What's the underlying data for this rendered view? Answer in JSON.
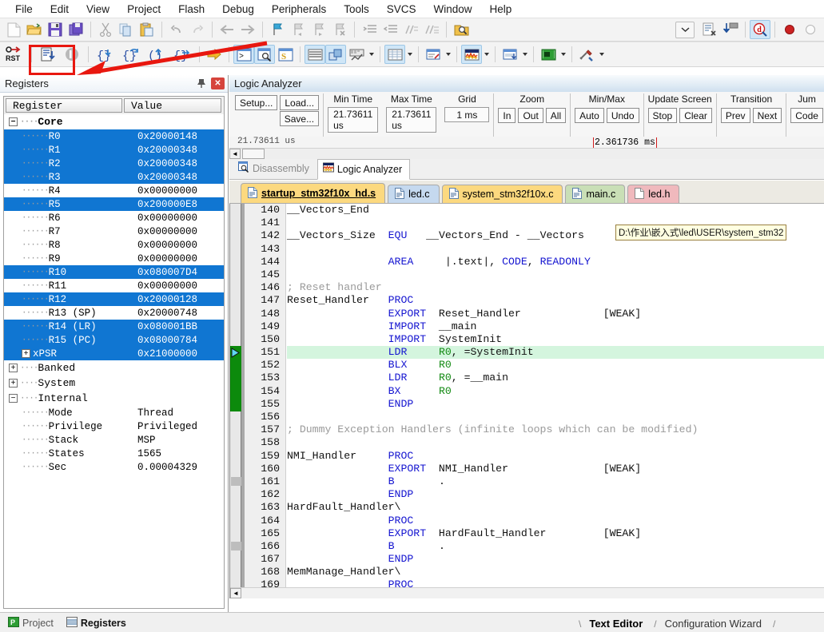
{
  "menubar": {
    "items": [
      "File",
      "Edit",
      "View",
      "Project",
      "Flash",
      "Debug",
      "Peripherals",
      "Tools",
      "SVCS",
      "Window",
      "Help"
    ]
  },
  "toolbar_main": {
    "icons": [
      "new-file-icon",
      "open-folder-icon",
      "save-icon",
      "save-all-icon",
      "cut-icon",
      "copy-icon",
      "paste-icon",
      "undo-icon",
      "redo-icon",
      "navigate-back-icon",
      "navigate-forward-icon",
      "bookmark-toggle-icon",
      "bookmark-prev-icon",
      "bookmark-next-icon",
      "bookmark-clear-icon",
      "indent-icon",
      "outdent-icon",
      "comment-icon",
      "uncomment-icon",
      "find-in-files-icon",
      "target-select-dropdown-icon",
      "build-target-icon",
      "download-icon",
      "start-debug-icon",
      "insert-breakpoint-icon",
      "disable-breakpoint-icon"
    ]
  },
  "toolbar_debug": {
    "icons": [
      "reset-cpu-icon",
      "run-icon",
      "stop-icon",
      "step-into-icon",
      "step-over-icon",
      "step-out-icon",
      "run-to-cursor-icon",
      "show-next-statement-icon",
      "command-window-icon",
      "disassembly-window-icon",
      "symbols-window-icon",
      "registers-window-icon",
      "call-stack-icon",
      "watch-window-icon",
      "memory-window-icon",
      "serial-window-icon",
      "analysis-window-icon",
      "trace-window-icon",
      "system-viewer-icon",
      "toolbox-icon"
    ],
    "highlighted_icon": "run-icon"
  },
  "registers_pane": {
    "title": "Registers",
    "pin_icon": "pin-icon",
    "close_icon": "close-icon",
    "columns": [
      "Register",
      "Value"
    ],
    "groups": [
      {
        "name": "Core",
        "expander": "−",
        "expanded": true
      },
      {
        "name": "Banked",
        "expander": "+",
        "expanded": false
      },
      {
        "name": "System",
        "expander": "+",
        "expanded": false
      },
      {
        "name": "Internal",
        "expander": "−",
        "expanded": true
      }
    ],
    "core_rows": [
      {
        "name": "R0",
        "value": "0x20000148",
        "selected": true
      },
      {
        "name": "R1",
        "value": "0x20000348",
        "selected": true
      },
      {
        "name": "R2",
        "value": "0x20000348",
        "selected": true
      },
      {
        "name": "R3",
        "value": "0x20000348",
        "selected": true
      },
      {
        "name": "R4",
        "value": "0x00000000",
        "selected": false
      },
      {
        "name": "R5",
        "value": "0x200000E8",
        "selected": true
      },
      {
        "name": "R6",
        "value": "0x00000000",
        "selected": false
      },
      {
        "name": "R7",
        "value": "0x00000000",
        "selected": false
      },
      {
        "name": "R8",
        "value": "0x00000000",
        "selected": false
      },
      {
        "name": "R9",
        "value": "0x00000000",
        "selected": false
      },
      {
        "name": "R10",
        "value": "0x080007D4",
        "selected": true
      },
      {
        "name": "R11",
        "value": "0x00000000",
        "selected": false
      },
      {
        "name": "R12",
        "value": "0x20000128",
        "selected": true
      },
      {
        "name": "R13 (SP)",
        "value": "0x20000748",
        "selected": false
      },
      {
        "name": "R14 (LR)",
        "value": "0x080001BB",
        "selected": true
      },
      {
        "name": "R15 (PC)",
        "value": "0x08000784",
        "selected": true
      },
      {
        "name": "xPSR",
        "value": "0x21000000",
        "selected": true,
        "expander": "+"
      }
    ],
    "internal_rows": [
      {
        "name": "Mode",
        "value": "Thread"
      },
      {
        "name": "Privilege",
        "value": "Privileged"
      },
      {
        "name": "Stack",
        "value": "MSP"
      },
      {
        "name": "States",
        "value": "1565"
      },
      {
        "name": "Sec",
        "value": "0.00004329"
      }
    ],
    "selection_color": "#1076d2"
  },
  "logic_analyzer": {
    "title": "Logic Analyzer",
    "buttons": {
      "setup": "Setup...",
      "load": "Load...",
      "save": "Save..."
    },
    "fields": [
      {
        "label": "Min Time",
        "value": "21.73611 us"
      },
      {
        "label": "Max Time",
        "value": "21.73611 us"
      },
      {
        "label": "Grid",
        "value": "1 ms"
      }
    ],
    "groups": [
      {
        "label": "Zoom",
        "buttons": [
          "In",
          "Out",
          "All"
        ]
      },
      {
        "label": "Min/Max",
        "buttons": [
          "Auto",
          "Undo"
        ]
      },
      {
        "label": "Update Screen",
        "buttons": [
          "Stop",
          "Clear"
        ]
      },
      {
        "label": "Transition",
        "buttons": [
          "Prev",
          "Next"
        ]
      },
      {
        "label": "Jum",
        "buttons": [
          "Code"
        ]
      }
    ],
    "wave_left_label": "21.73611 us",
    "cursor_readout": "2.361736 ms"
  },
  "view_tabs": [
    {
      "label": "Disassembly",
      "icon": "disassembly-icon",
      "active": false
    },
    {
      "label": "Logic Analyzer",
      "icon": "logic-analyzer-icon",
      "active": true
    }
  ],
  "file_tabs": [
    {
      "label": "startup_stm32f10x_hd.s",
      "icon": "asm-file-icon",
      "active": true,
      "color": "#fcd97f"
    },
    {
      "label": "led.c",
      "icon": "c-file-icon",
      "active": false,
      "color": "#c5d9ef"
    },
    {
      "label": "system_stm32f10x.c",
      "icon": "c-file-icon",
      "active": false,
      "color": "#fcd97f"
    },
    {
      "label": "main.c",
      "icon": "c-file-icon",
      "active": false,
      "color": "#c9dfb6"
    },
    {
      "label": "led.h",
      "icon": "h-file-icon",
      "active": false,
      "color": "#f0b9bd"
    }
  ],
  "tooltip": {
    "text": "D:\\作业\\嵌入式\\led\\USER\\system_stm32"
  },
  "editor": {
    "first_line": 140,
    "current_line": 151,
    "pc_block_lines": [
      151,
      155
    ],
    "breakpoint_lines": [
      161,
      166
    ],
    "lines": [
      {
        "n": 140,
        "tokens": [
          {
            "t": "__Vectors_End",
            "c": "pln"
          }
        ]
      },
      {
        "n": 141,
        "tokens": []
      },
      {
        "n": 142,
        "tokens": [
          {
            "t": "__Vectors_Size  ",
            "c": "pln"
          },
          {
            "t": "EQU",
            "c": "kw"
          },
          {
            "t": "   __Vectors_End - __Vectors",
            "c": "pln"
          }
        ]
      },
      {
        "n": 143,
        "tokens": []
      },
      {
        "n": 144,
        "tokens": [
          {
            "t": "                ",
            "c": "pln"
          },
          {
            "t": "AREA",
            "c": "kw"
          },
          {
            "t": "     |.text|, ",
            "c": "pln"
          },
          {
            "t": "CODE",
            "c": "kw"
          },
          {
            "t": ", ",
            "c": "pln"
          },
          {
            "t": "READONLY",
            "c": "kw"
          }
        ]
      },
      {
        "n": 145,
        "tokens": []
      },
      {
        "n": 146,
        "tokens": [
          {
            "t": "; Reset handler",
            "c": "cmt"
          }
        ]
      },
      {
        "n": 147,
        "tokens": [
          {
            "t": "Reset_Handler   ",
            "c": "pln"
          },
          {
            "t": "PROC",
            "c": "kw"
          }
        ]
      },
      {
        "n": 148,
        "tokens": [
          {
            "t": "                ",
            "c": "pln"
          },
          {
            "t": "EXPORT",
            "c": "kw"
          },
          {
            "t": "  Reset_Handler             [WEAK]",
            "c": "pln"
          }
        ]
      },
      {
        "n": 149,
        "tokens": [
          {
            "t": "                ",
            "c": "pln"
          },
          {
            "t": "IMPORT",
            "c": "kw"
          },
          {
            "t": "  __main",
            "c": "pln"
          }
        ]
      },
      {
        "n": 150,
        "tokens": [
          {
            "t": "                ",
            "c": "pln"
          },
          {
            "t": "IMPORT",
            "c": "kw"
          },
          {
            "t": "  SystemInit",
            "c": "pln"
          }
        ]
      },
      {
        "n": 151,
        "tokens": [
          {
            "t": "                ",
            "c": "pln"
          },
          {
            "t": "LDR",
            "c": "kw"
          },
          {
            "t": "     ",
            "c": "pln"
          },
          {
            "t": "R0",
            "c": "reg2"
          },
          {
            "t": ", =SystemInit",
            "c": "pln"
          }
        ]
      },
      {
        "n": 152,
        "tokens": [
          {
            "t": "                ",
            "c": "pln"
          },
          {
            "t": "BLX",
            "c": "kw"
          },
          {
            "t": "     ",
            "c": "pln"
          },
          {
            "t": "R0",
            "c": "reg2"
          }
        ]
      },
      {
        "n": 153,
        "tokens": [
          {
            "t": "                ",
            "c": "pln"
          },
          {
            "t": "LDR",
            "c": "kw"
          },
          {
            "t": "     ",
            "c": "pln"
          },
          {
            "t": "R0",
            "c": "reg2"
          },
          {
            "t": ", =__main",
            "c": "pln"
          }
        ]
      },
      {
        "n": 154,
        "tokens": [
          {
            "t": "                ",
            "c": "pln"
          },
          {
            "t": "BX",
            "c": "kw"
          },
          {
            "t": "      ",
            "c": "pln"
          },
          {
            "t": "R0",
            "c": "reg2"
          }
        ]
      },
      {
        "n": 155,
        "tokens": [
          {
            "t": "                ",
            "c": "pln"
          },
          {
            "t": "ENDP",
            "c": "kw"
          }
        ]
      },
      {
        "n": 156,
        "tokens": []
      },
      {
        "n": 157,
        "tokens": [
          {
            "t": "; Dummy Exception Handlers (infinite loops which can be modified)",
            "c": "cmt"
          }
        ]
      },
      {
        "n": 158,
        "tokens": []
      },
      {
        "n": 159,
        "tokens": [
          {
            "t": "NMI_Handler     ",
            "c": "pln"
          },
          {
            "t": "PROC",
            "c": "kw"
          }
        ]
      },
      {
        "n": 160,
        "tokens": [
          {
            "t": "                ",
            "c": "pln"
          },
          {
            "t": "EXPORT",
            "c": "kw"
          },
          {
            "t": "  NMI_Handler               [WEAK]",
            "c": "pln"
          }
        ]
      },
      {
        "n": 161,
        "tokens": [
          {
            "t": "                ",
            "c": "pln"
          },
          {
            "t": "B",
            "c": "kw"
          },
          {
            "t": "       .",
            "c": "pln"
          }
        ]
      },
      {
        "n": 162,
        "tokens": [
          {
            "t": "                ",
            "c": "pln"
          },
          {
            "t": "ENDP",
            "c": "kw"
          }
        ]
      },
      {
        "n": 163,
        "tokens": [
          {
            "t": "HardFault_Handler\\",
            "c": "pln"
          }
        ]
      },
      {
        "n": 164,
        "tokens": [
          {
            "t": "                ",
            "c": "pln"
          },
          {
            "t": "PROC",
            "c": "kw"
          }
        ]
      },
      {
        "n": 165,
        "tokens": [
          {
            "t": "                ",
            "c": "pln"
          },
          {
            "t": "EXPORT",
            "c": "kw"
          },
          {
            "t": "  HardFault_Handler         [WEAK]",
            "c": "pln"
          }
        ]
      },
      {
        "n": 166,
        "tokens": [
          {
            "t": "                ",
            "c": "pln"
          },
          {
            "t": "B",
            "c": "kw"
          },
          {
            "t": "       .",
            "c": "pln"
          }
        ]
      },
      {
        "n": 167,
        "tokens": [
          {
            "t": "                ",
            "c": "pln"
          },
          {
            "t": "ENDP",
            "c": "kw"
          }
        ]
      },
      {
        "n": 168,
        "tokens": [
          {
            "t": "MemManage_Handler\\",
            "c": "pln"
          }
        ]
      },
      {
        "n": 169,
        "tokens": [
          {
            "t": "                ",
            "c": "pln"
          },
          {
            "t": "PROC",
            "c": "kw"
          }
        ]
      }
    ]
  },
  "status_tabs": {
    "left": [
      {
        "label": "Project",
        "icon": "project-icon",
        "active": false
      },
      {
        "label": "Registers",
        "icon": "registers-icon",
        "active": true
      }
    ],
    "right": [
      {
        "label": "Text Editor",
        "active": true
      },
      {
        "label": "Configuration Wizard",
        "active": false
      }
    ]
  },
  "annotation": {
    "color": "#e8170f"
  }
}
